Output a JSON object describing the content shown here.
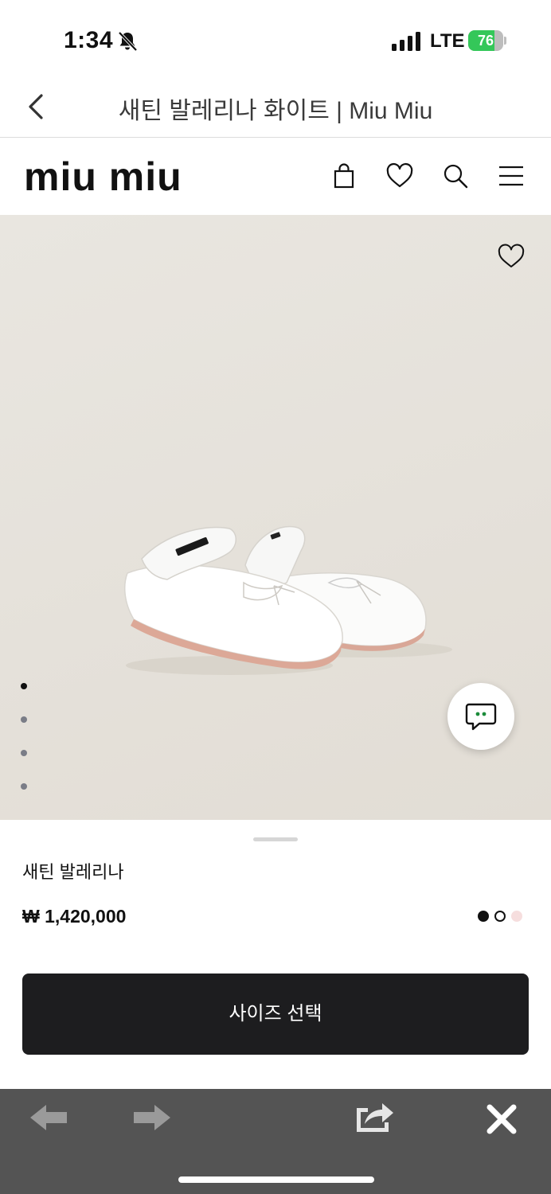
{
  "status_bar": {
    "time": "1:34",
    "network": "LTE",
    "battery": "76",
    "battery_level": 0.76,
    "battery_color": "#34c759"
  },
  "browser": {
    "title": "새틴 발레리나 화이트 | Miu Miu"
  },
  "site": {
    "brand": "miu miu"
  },
  "product": {
    "name": "새틴 발레리나",
    "price": "₩ 1,420,000",
    "gallery_count": 4,
    "gallery_active_index": 0,
    "colors": [
      {
        "name": "black",
        "hex": "#111111",
        "selected": false
      },
      {
        "name": "white",
        "hex": "#ffffff",
        "selected": true
      },
      {
        "name": "pink",
        "hex": "#f6dede",
        "selected": false
      }
    ],
    "cta_label": "사이즈 선택"
  },
  "icons": {
    "header": [
      "shopping-bag-icon",
      "heart-icon",
      "search-icon",
      "menu-icon"
    ],
    "toolbar": [
      "back-arrow-icon",
      "forward-arrow-icon",
      "share-icon",
      "close-icon"
    ]
  },
  "theme": {
    "toolbar_bg": "#545454",
    "cta_bg": "#1d1d1f"
  }
}
